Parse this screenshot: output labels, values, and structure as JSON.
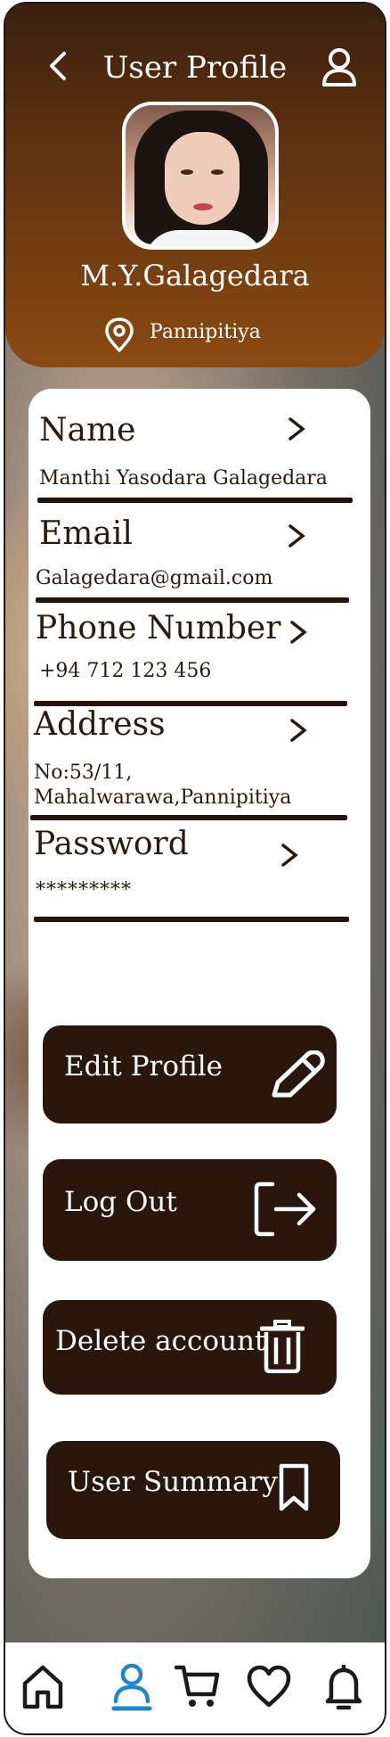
{
  "header": {
    "title": "User Profile",
    "display_name": "M.Y.Galagedara",
    "location": "Pannipitiya"
  },
  "fields": [
    {
      "label": "Name",
      "value": "Manthi Yasodara Galagedara"
    },
    {
      "label": "Email",
      "value": "Galagedara@gmail.com"
    },
    {
      "label": "Phone Number",
      "value": "+94 712 123 456"
    },
    {
      "label": "Address",
      "value_line1": "No:53/11,",
      "value_line2": "Mahalwarawa,Pannipitiya"
    },
    {
      "label": "Password",
      "value": "*********"
    }
  ],
  "chevron": ">",
  "buttons": {
    "edit": "Edit Profile",
    "logout": "Log Out",
    "delete": "Delete account",
    "summary": "User Summary"
  },
  "icons": {
    "back": "chevron-left-icon",
    "profile": "user-icon",
    "location": "map-pin-icon",
    "edit": "pencil-icon",
    "logout": "logout-icon",
    "delete": "trash-icon",
    "summary": "bookmark-icon",
    "nav": [
      "home-icon",
      "user-icon",
      "cart-icon",
      "heart-icon",
      "bell-icon"
    ]
  },
  "navbar": {
    "active_index": 1
  },
  "colors": {
    "header_dark": "#3a1f0f",
    "header_light": "#8b4a12",
    "button_bg": "#2a160a",
    "text_dark": "#2a1a0e",
    "nav_active": "#1e88c7",
    "card_bg": "#ffffff"
  }
}
